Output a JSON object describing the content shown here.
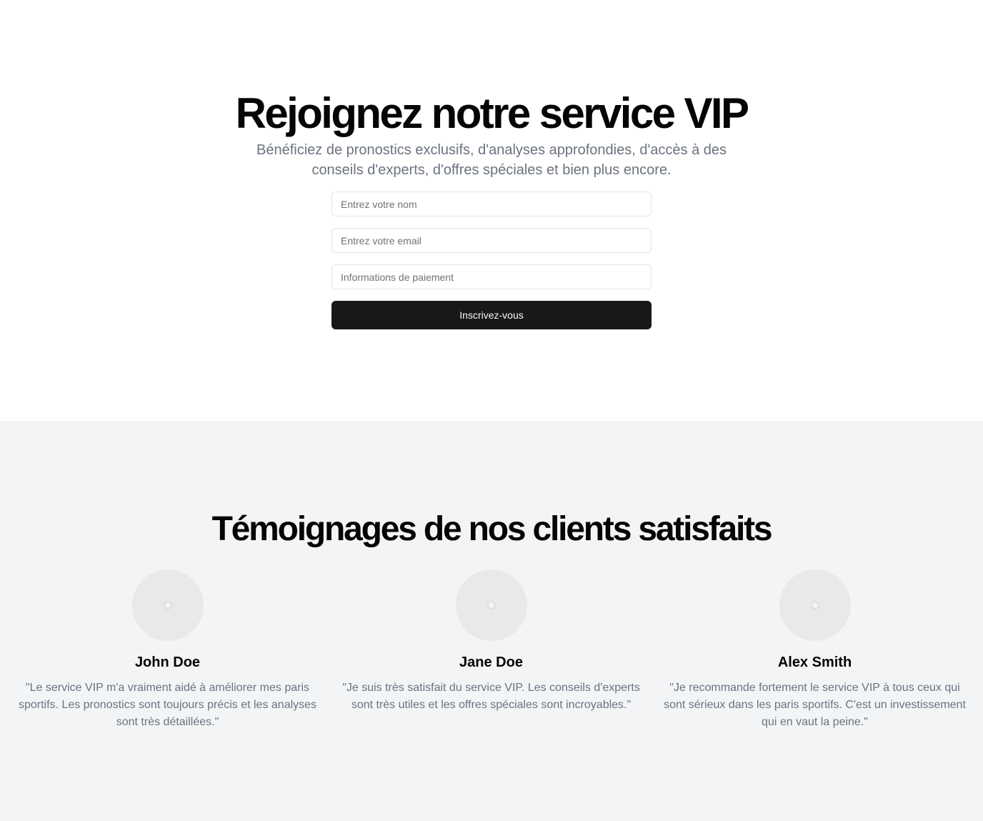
{
  "signup": {
    "title": "Rejoignez notre service VIP",
    "subtitle": "Bénéficiez de pronostics exclusifs, d'analyses approfondies, d'accès à des conseils d'experts, d'offres spéciales et bien plus encore.",
    "name_placeholder": "Entrez votre nom",
    "email_placeholder": "Entrez votre email",
    "payment_placeholder": "Informations de paiement",
    "submit_label": "Inscrivez-vous"
  },
  "testimonials": {
    "title": "Témoignages de nos clients satisfaits",
    "items": [
      {
        "name": "John Doe",
        "quote": "\"Le service VIP m'a vraiment aidé à améliorer mes paris sportifs. Les pronostics sont toujours précis et les analyses sont très détaillées.\""
      },
      {
        "name": "Jane Doe",
        "quote": "\"Je suis très satisfait du service VIP. Les conseils d'experts sont très utiles et les offres spéciales sont incroyables.\""
      },
      {
        "name": "Alex Smith",
        "quote": "\"Je recommande fortement le service VIP à tous ceux qui sont sérieux dans les paris sportifs. C'est un investissement qui en vaut la peine.\""
      }
    ]
  }
}
